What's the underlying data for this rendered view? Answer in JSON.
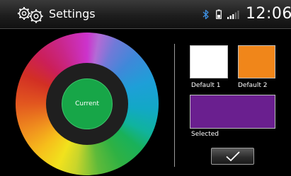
{
  "header": {
    "title": "Settings",
    "clock": "12:06",
    "icons": [
      "gears-icon",
      "bluetooth-icon",
      "battery-icon",
      "signal-icon"
    ]
  },
  "wheel": {
    "center_label": "Current",
    "current_color": "#17a648"
  },
  "swatches": {
    "default1": {
      "label": "Default 1",
      "color": "#ffffff"
    },
    "default2": {
      "label": "Default 2",
      "color": "#f0861a"
    },
    "selected": {
      "label": "Selected",
      "color": "#6a1f8f"
    }
  },
  "confirm_button": {
    "icon": "checkmark-icon"
  }
}
